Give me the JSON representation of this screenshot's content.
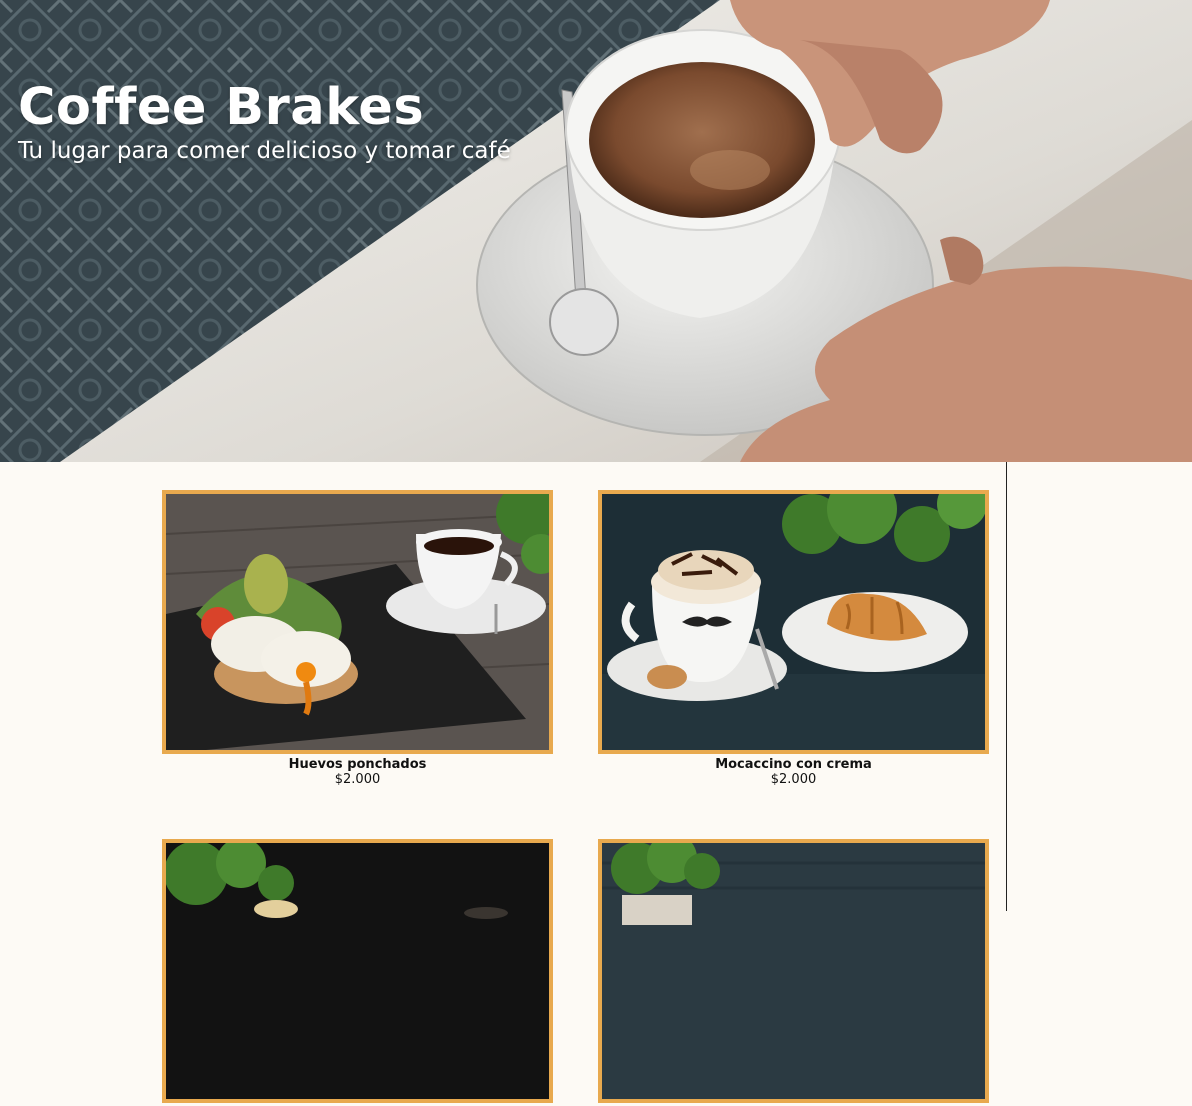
{
  "hero": {
    "title": "Coffee Brakes",
    "subtitle": "Tu lugar para comer delicioso y tomar café"
  },
  "menu": {
    "items": [
      {
        "name": "Huevos ponchados",
        "price": "$2.000",
        "image": "poached-eggs-photo"
      },
      {
        "name": "Mocaccino con crema",
        "price": "$2.000",
        "image": "mocaccino-photo"
      },
      {
        "name": "",
        "price": "",
        "image": "dark-coffee-photo"
      },
      {
        "name": "",
        "price": "",
        "image": "plant-table-photo"
      }
    ]
  },
  "colors": {
    "background": "#fdfaf5",
    "card_border": "#e8a94e",
    "hero_text": "#ffffff"
  }
}
